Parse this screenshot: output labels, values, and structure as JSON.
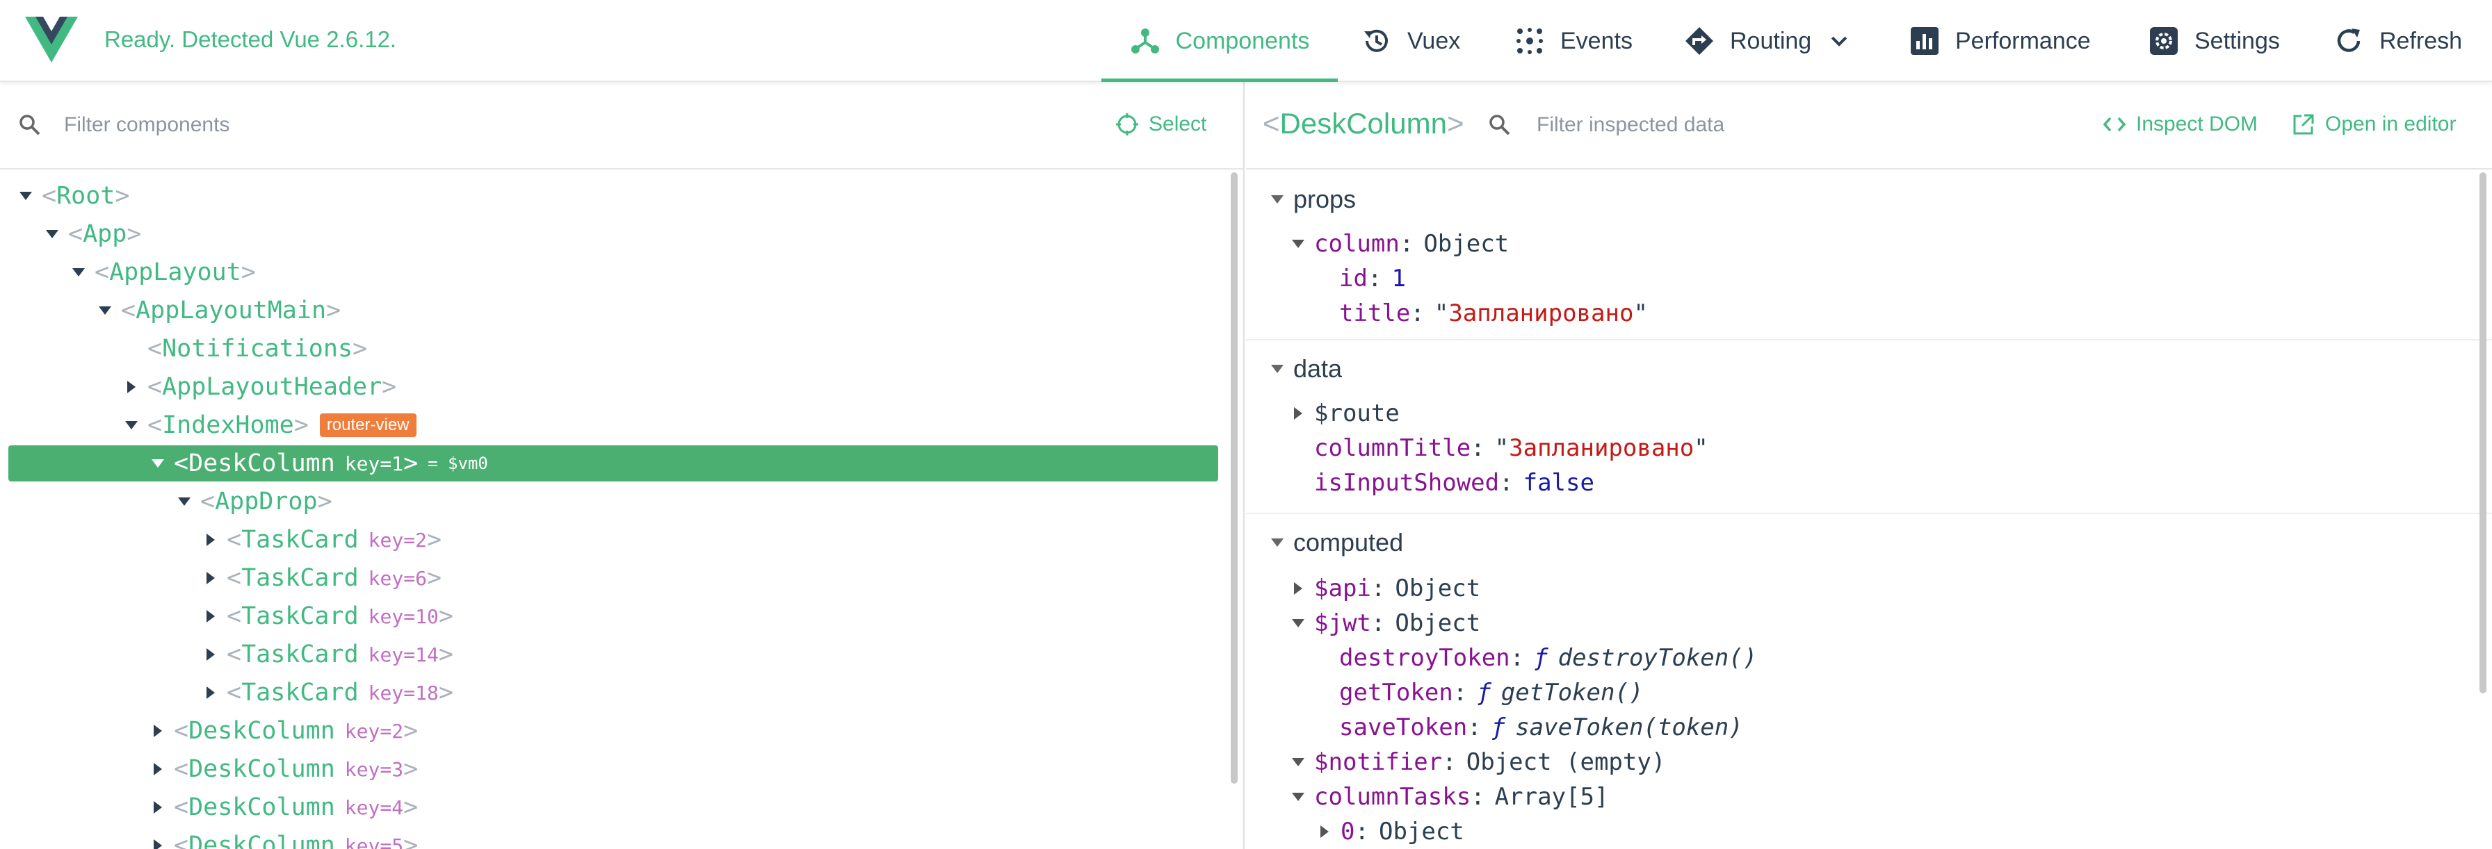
{
  "header": {
    "status": "Ready. Detected Vue 2.6.12.",
    "nav": [
      {
        "label": "Components",
        "icon": "components-icon",
        "active": true
      },
      {
        "label": "Vuex",
        "icon": "history-icon"
      },
      {
        "label": "Events",
        "icon": "events-icon"
      },
      {
        "label": "Routing",
        "icon": "routing-icon"
      },
      {
        "label": "Performance",
        "icon": "performance-icon"
      },
      {
        "label": "Settings",
        "icon": "settings-icon"
      },
      {
        "label": "Refresh",
        "icon": "refresh-icon"
      }
    ]
  },
  "left": {
    "filter_placeholder": "Filter components",
    "select_label": "Select",
    "tree": [
      {
        "name": "Root"
      },
      {
        "name": "App"
      },
      {
        "name": "AppLayout"
      },
      {
        "name": "AppLayoutMain"
      },
      {
        "name": "Notifications"
      },
      {
        "name": "AppLayoutHeader"
      },
      {
        "name": "IndexHome",
        "badge": "router-view"
      },
      {
        "name": "DeskColumn",
        "attr": "key=1",
        "vm": "= $vm0"
      },
      {
        "name": "AppDrop"
      },
      {
        "name": "TaskCard",
        "attr": "key=2"
      },
      {
        "name": "TaskCard",
        "attr": "key=6"
      },
      {
        "name": "TaskCard",
        "attr": "key=10"
      },
      {
        "name": "TaskCard",
        "attr": "key=14"
      },
      {
        "name": "TaskCard",
        "attr": "key=18"
      },
      {
        "name": "DeskColumn",
        "attr": "key=2"
      },
      {
        "name": "DeskColumn",
        "attr": "key=3"
      },
      {
        "name": "DeskColumn",
        "attr": "key=4"
      },
      {
        "name": "DeskColumn",
        "attr": "key=5"
      }
    ]
  },
  "right": {
    "selected_component": "DeskColumn",
    "filter_placeholder": "Filter inspected data",
    "inspect_dom_label": "Inspect DOM",
    "open_editor_label": "Open in editor",
    "sections": {
      "props": {
        "title": "props",
        "items": [
          {
            "key": "column",
            "value": "Object"
          },
          {
            "key": "id",
            "value": "1"
          },
          {
            "key": "title",
            "value": "Запланировано"
          }
        ]
      },
      "data": {
        "title": "data",
        "items": [
          {
            "key": "$route",
            "value": ""
          },
          {
            "key": "columnTitle",
            "value": "Запланировано"
          },
          {
            "key": "isInputShowed",
            "value": "false"
          }
        ]
      },
      "computed": {
        "title": "computed",
        "items": [
          {
            "key": "$api",
            "value": "Object"
          },
          {
            "key": "$jwt",
            "value": "Object"
          },
          {
            "key": "destroyToken",
            "value": "destroyToken()"
          },
          {
            "key": "getToken",
            "value": "getToken()"
          },
          {
            "key": "saveToken",
            "value": "saveToken(token)"
          },
          {
            "key": "$notifier",
            "value": "Object (empty)"
          },
          {
            "key": "columnTasks",
            "value": "Array[5]"
          },
          {
            "key": "0",
            "value": "Object"
          }
        ]
      }
    }
  },
  "colors": {
    "accent": "#42b983",
    "selected_row": "#4caf72",
    "badge": "#ef7d3c",
    "key": "#881391",
    "string": "#c41a16",
    "number": "#1a1aa6"
  }
}
